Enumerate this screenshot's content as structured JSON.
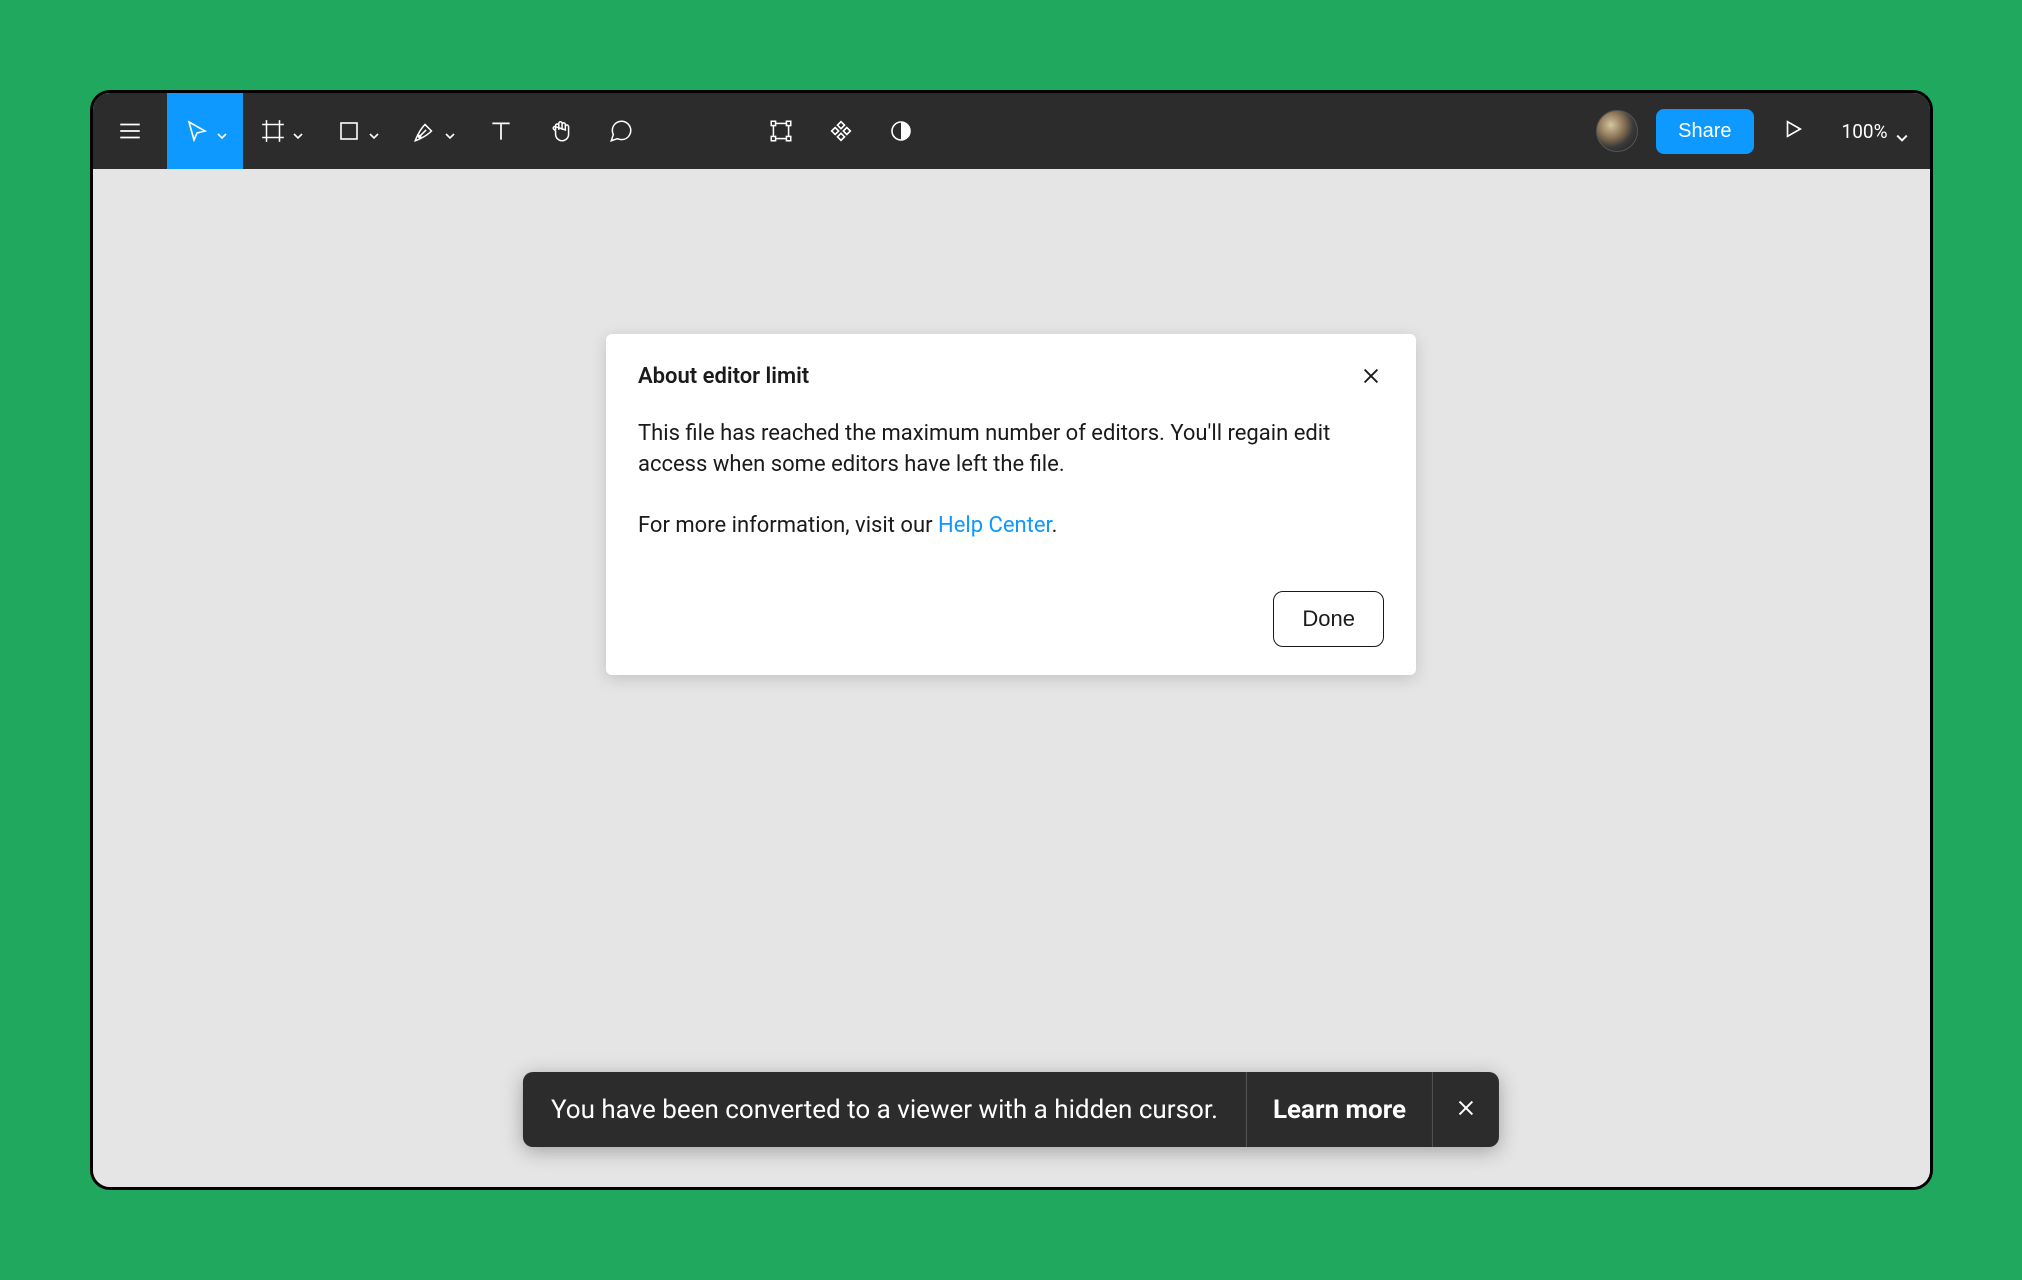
{
  "toolbar": {
    "share_label": "Share",
    "zoom_level": "100%"
  },
  "modal": {
    "title": "About editor limit",
    "body_p1": "This file has reached the maximum number of editors. You'll regain edit access when some editors have left the file.",
    "body_p2_prefix": "For more information, visit our ",
    "help_link_text": "Help Center",
    "body_p2_suffix": ".",
    "done_label": "Done"
  },
  "toast": {
    "message": "You have been converted to a viewer with a hidden cursor.",
    "learn_more_label": "Learn more"
  },
  "colors": {
    "page_bg": "#20a85f",
    "toolbar_bg": "#2c2c2c",
    "accent": "#0d99ff",
    "canvas_bg": "#e5e5e5"
  }
}
